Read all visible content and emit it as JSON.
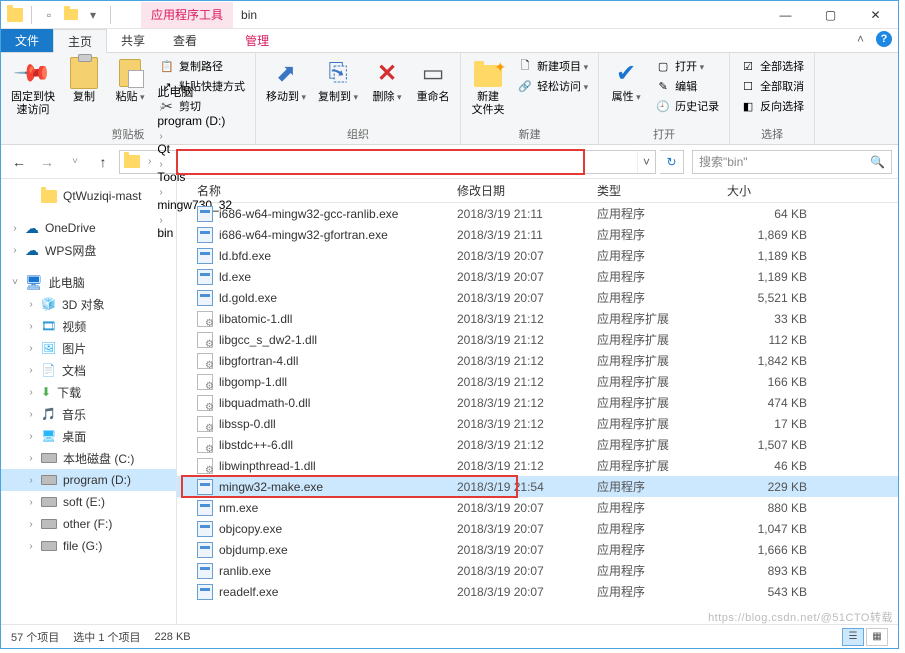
{
  "title": "bin",
  "context_tab": "应用程序工具",
  "tabs": {
    "file": "文件",
    "home": "主页",
    "share": "共享",
    "view": "查看",
    "manage": "管理"
  },
  "ribbon": {
    "pin": {
      "label": "固定到快\n速访问"
    },
    "copy": "复制",
    "paste": "粘贴",
    "copypath": "复制路径",
    "pasteshortcut": "粘贴快捷方式",
    "cut": "剪切",
    "clipboard_group": "剪贴板",
    "moveto": "移动到",
    "copyto": "复制到",
    "delete": "删除",
    "rename": "重命名",
    "organize_group": "组织",
    "newfolder": "新建\n文件夹",
    "newitem": "新建项目",
    "easyaccess": "轻松访问",
    "new_group": "新建",
    "properties": "属性",
    "open": "打开",
    "edit": "编辑",
    "history": "历史记录",
    "open_group": "打开",
    "selectall": "全部选择",
    "selectnone": "全部取消",
    "invert": "反向选择",
    "select_group": "选择"
  },
  "breadcrumb": [
    "此电脑",
    "program (D:)",
    "Qt",
    "Tools",
    "mingw730_32",
    "bin"
  ],
  "search_placeholder": "搜索\"bin\"",
  "columns": {
    "name": "名称",
    "date": "修改日期",
    "type": "类型",
    "size": "大小"
  },
  "sidebar": {
    "quick": [
      {
        "label": "QtWuziqi-mast",
        "icon": "folder"
      }
    ],
    "clouds": [
      {
        "label": "OneDrive",
        "icon": "cloud"
      },
      {
        "label": "WPS网盘",
        "icon": "cloud"
      }
    ],
    "thispc": "此电脑",
    "libs": [
      {
        "label": "3D 对象",
        "icon": "3d"
      },
      {
        "label": "视频",
        "icon": "video"
      },
      {
        "label": "图片",
        "icon": "pic"
      },
      {
        "label": "文档",
        "icon": "doc"
      },
      {
        "label": "下载",
        "icon": "dl"
      },
      {
        "label": "音乐",
        "icon": "music"
      },
      {
        "label": "桌面",
        "icon": "desk"
      }
    ],
    "drives": [
      {
        "label": "本地磁盘 (C:)"
      },
      {
        "label": "program (D:)",
        "selected": true
      },
      {
        "label": "soft (E:)"
      },
      {
        "label": "other (F:)"
      },
      {
        "label": "file (G:)"
      }
    ]
  },
  "files": [
    {
      "name": "i686-w64-mingw32-gcc-ranlib.exe",
      "date": "2018/3/19 21:11",
      "type": "应用程序",
      "size": "64 KB",
      "ext": "exe"
    },
    {
      "name": "i686-w64-mingw32-gfortran.exe",
      "date": "2018/3/19 21:11",
      "type": "应用程序",
      "size": "1,869 KB",
      "ext": "exe"
    },
    {
      "name": "ld.bfd.exe",
      "date": "2018/3/19 20:07",
      "type": "应用程序",
      "size": "1,189 KB",
      "ext": "exe"
    },
    {
      "name": "ld.exe",
      "date": "2018/3/19 20:07",
      "type": "应用程序",
      "size": "1,189 KB",
      "ext": "exe"
    },
    {
      "name": "ld.gold.exe",
      "date": "2018/3/19 20:07",
      "type": "应用程序",
      "size": "5,521 KB",
      "ext": "exe"
    },
    {
      "name": "libatomic-1.dll",
      "date": "2018/3/19 21:12",
      "type": "应用程序扩展",
      "size": "33 KB",
      "ext": "dll"
    },
    {
      "name": "libgcc_s_dw2-1.dll",
      "date": "2018/3/19 21:12",
      "type": "应用程序扩展",
      "size": "112 KB",
      "ext": "dll"
    },
    {
      "name": "libgfortran-4.dll",
      "date": "2018/3/19 21:12",
      "type": "应用程序扩展",
      "size": "1,842 KB",
      "ext": "dll"
    },
    {
      "name": "libgomp-1.dll",
      "date": "2018/3/19 21:12",
      "type": "应用程序扩展",
      "size": "166 KB",
      "ext": "dll"
    },
    {
      "name": "libquadmath-0.dll",
      "date": "2018/3/19 21:12",
      "type": "应用程序扩展",
      "size": "474 KB",
      "ext": "dll"
    },
    {
      "name": "libssp-0.dll",
      "date": "2018/3/19 21:12",
      "type": "应用程序扩展",
      "size": "17 KB",
      "ext": "dll"
    },
    {
      "name": "libstdc++-6.dll",
      "date": "2018/3/19 21:12",
      "type": "应用程序扩展",
      "size": "1,507 KB",
      "ext": "dll"
    },
    {
      "name": "libwinpthread-1.dll",
      "date": "2018/3/19 21:12",
      "type": "应用程序扩展",
      "size": "46 KB",
      "ext": "dll"
    },
    {
      "name": "mingw32-make.exe",
      "date": "2018/3/19 21:54",
      "type": "应用程序",
      "size": "229 KB",
      "ext": "exe",
      "selected": true
    },
    {
      "name": "nm.exe",
      "date": "2018/3/19 20:07",
      "type": "应用程序",
      "size": "880 KB",
      "ext": "exe"
    },
    {
      "name": "objcopy.exe",
      "date": "2018/3/19 20:07",
      "type": "应用程序",
      "size": "1,047 KB",
      "ext": "exe"
    },
    {
      "name": "objdump.exe",
      "date": "2018/3/19 20:07",
      "type": "应用程序",
      "size": "1,666 KB",
      "ext": "exe"
    },
    {
      "name": "ranlib.exe",
      "date": "2018/3/19 20:07",
      "type": "应用程序",
      "size": "893 KB",
      "ext": "exe"
    },
    {
      "name": "readelf.exe",
      "date": "2018/3/19 20:07",
      "type": "应用程序",
      "size": "543 KB",
      "ext": "exe"
    }
  ],
  "status": {
    "count": "57 个项目",
    "selection": "选中 1 个项目",
    "selsize": "228 KB"
  },
  "watermark": "https://blog.csdn.net/@51CTO转载"
}
